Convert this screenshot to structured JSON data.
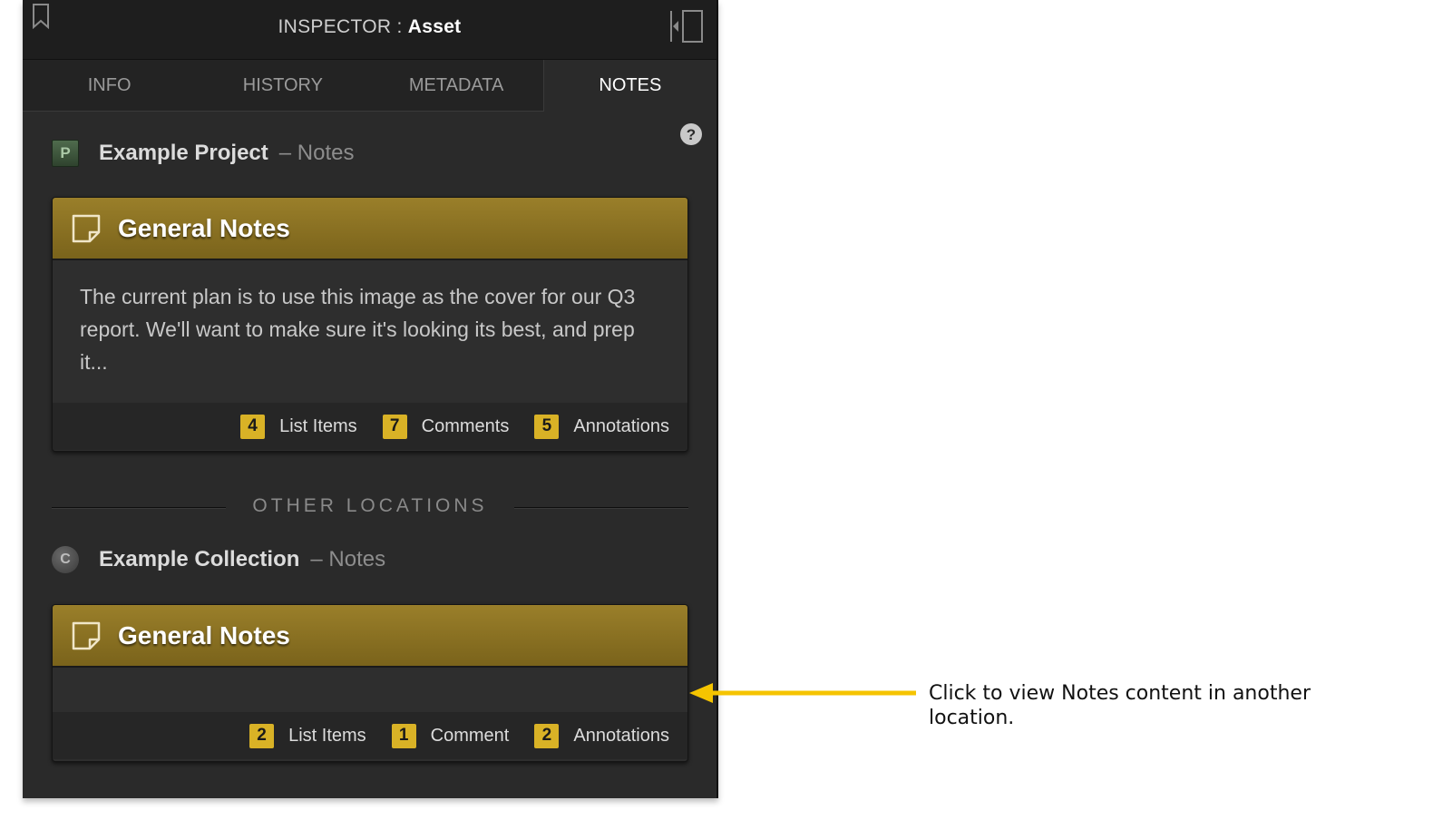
{
  "inspector": {
    "title_prefix": "INSPECTOR :",
    "title_object": "Asset"
  },
  "tabs": [
    {
      "label": "INFO",
      "active": false
    },
    {
      "label": "HISTORY",
      "active": false
    },
    {
      "label": "METADATA",
      "active": false
    },
    {
      "label": "NOTES",
      "active": true
    }
  ],
  "primary_location": {
    "badge": "P",
    "name": "Example Project",
    "suffix": "– Notes",
    "card": {
      "title": "General Notes",
      "body": "The current plan is to use this image as the cover for our Q3 report. We'll want to make sure it's looking its best, and prep it...",
      "stats": [
        {
          "count": "4",
          "label": "List Items"
        },
        {
          "count": "7",
          "label": "Comments"
        },
        {
          "count": "5",
          "label": "Annotations"
        }
      ]
    }
  },
  "other_locations_label": "OTHER LOCATIONS",
  "other_location": {
    "badge": "C",
    "name": "Example Collection",
    "suffix": "– Notes",
    "card": {
      "title": "General Notes",
      "body": "",
      "stats": [
        {
          "count": "2",
          "label": "List Items"
        },
        {
          "count": "1",
          "label": "Comment"
        },
        {
          "count": "2",
          "label": "Annotations"
        }
      ]
    }
  },
  "callout": {
    "text": "Click to view Notes content in another location.",
    "arrow_color": "#f5c400"
  },
  "colors": {
    "accent_gold": "#d9b226",
    "header_gold": "#8c7322",
    "panel_bg": "#2a2a2a"
  }
}
